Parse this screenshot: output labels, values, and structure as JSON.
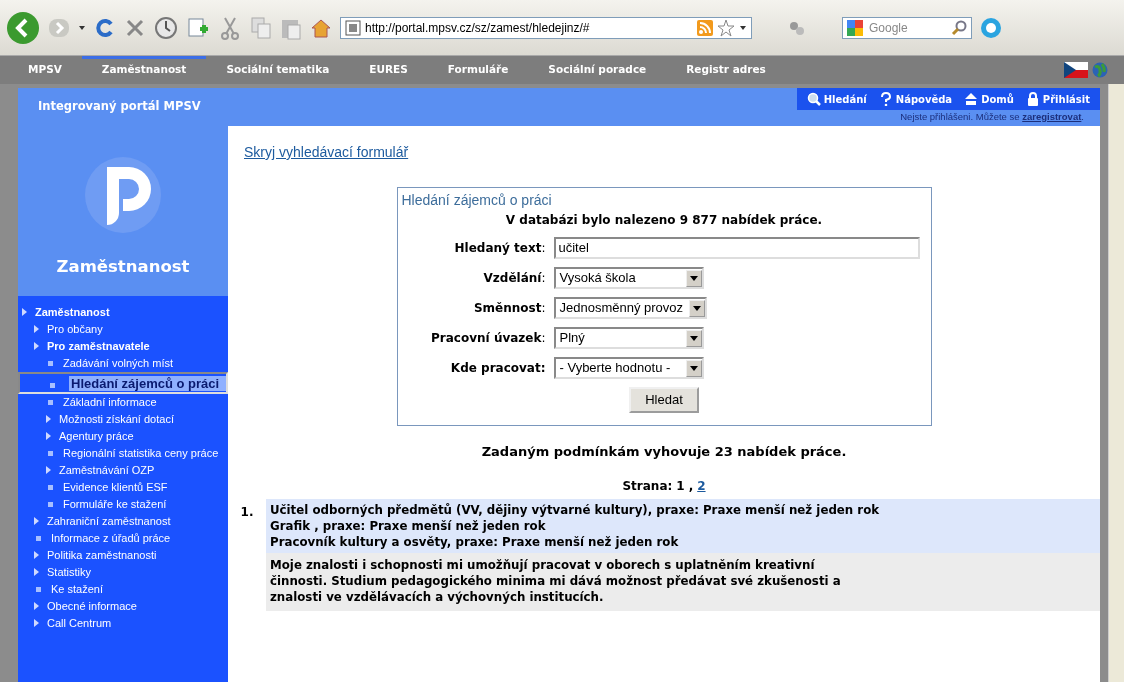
{
  "browser": {
    "url": "http://portal.mpsv.cz/sz/zamest/hledejinz/#",
    "search_placeholder": "Google"
  },
  "top_nav": [
    {
      "label": "MPSV",
      "selected": false
    },
    {
      "label": "Zaměstnanost",
      "selected": true
    },
    {
      "label": "Sociální tematika",
      "selected": false
    },
    {
      "label": "EURES",
      "selected": false
    },
    {
      "label": "Formuláře",
      "selected": false
    },
    {
      "label": "Sociální poradce",
      "selected": false
    },
    {
      "label": "Registr adres",
      "selected": false
    }
  ],
  "portal": {
    "title": "Integrovaný portál MPSV",
    "tools": [
      {
        "kind": "search",
        "label": "Hledání"
      },
      {
        "kind": "help",
        "label": "Nápověda"
      },
      {
        "kind": "home",
        "label": "Domů"
      },
      {
        "kind": "lock",
        "label": "Přihlásit"
      }
    ],
    "login_note": "Nejste přihlášeni. Můžete se",
    "register_link": "zaregistrovat",
    "note_end": "."
  },
  "sidebar": {
    "heading": "Zaměstnanost",
    "items": [
      {
        "label": "Zaměstnanost",
        "kind": "arrow",
        "expanded": true,
        "selected": false,
        "children": [
          {
            "label": "Pro občany",
            "kind": "arrow",
            "expanded": false,
            "selected": false
          },
          {
            "label": "Pro zaměstnavatele",
            "kind": "arrow",
            "expanded": true,
            "selected": false,
            "children": [
              {
                "label": "Zadávání volných míst",
                "kind": "bullet",
                "expanded": false,
                "selected": false
              },
              {
                "label": "Hledání zájemců o práci",
                "kind": "bullet",
                "expanded": false,
                "selected": true
              },
              {
                "label": "Základní informace",
                "kind": "bullet",
                "expanded": false,
                "selected": false
              },
              {
                "label": "Možnosti získání dotací",
                "kind": "arrow",
                "expanded": false,
                "selected": false
              },
              {
                "label": "Agentury práce",
                "kind": "arrow",
                "expanded": false,
                "selected": false
              },
              {
                "label": "Regionální statistika ceny práce",
                "kind": "bullet",
                "expanded": false,
                "selected": false
              },
              {
                "label": "Zaměstnávání OZP",
                "kind": "arrow",
                "expanded": false,
                "selected": false
              },
              {
                "label": "Evidence klientů ESF",
                "kind": "bullet",
                "expanded": false,
                "selected": false
              },
              {
                "label": "Formuláře ke stažení",
                "kind": "bullet",
                "expanded": false,
                "selected": false
              }
            ]
          },
          {
            "label": "Zahraniční zaměstnanost",
            "kind": "arrow",
            "expanded": false,
            "selected": false
          },
          {
            "label": "Informace z úřadů práce",
            "kind": "bullet",
            "expanded": false,
            "selected": false
          },
          {
            "label": "Politika zaměstnanosti",
            "kind": "arrow",
            "expanded": false,
            "selected": false
          },
          {
            "label": "Statistiky",
            "kind": "arrow",
            "expanded": false,
            "selected": false
          },
          {
            "label": "Ke stažení",
            "kind": "bullet",
            "expanded": false,
            "selected": false
          },
          {
            "label": "Obecné informace",
            "kind": "arrow",
            "expanded": false,
            "selected": false
          },
          {
            "label": "Call Centrum",
            "kind": "arrow",
            "expanded": false,
            "selected": false
          }
        ]
      }
    ]
  },
  "main": {
    "hide_link": "Skryj vyhledávací formulář",
    "form": {
      "legend": "Hledání zájemců o práci",
      "summary": "V databázi bylo nalezeno 9 877 nabídek práce.",
      "fields": [
        {
          "label": "Hledaný text",
          "colon": ":",
          "kind": "text",
          "value": "učitel",
          "bold_colon": false
        },
        {
          "label": "Vzdělání",
          "colon": ":",
          "kind": "select",
          "value": "Vysoká škola",
          "bold_colon": false
        },
        {
          "label": "Směnnost",
          "colon": ":",
          "kind": "select",
          "value": "Jednosměnný provoz",
          "bold_colon": false
        },
        {
          "label": "Pracovní úvazek",
          "colon": ":",
          "kind": "select",
          "value": "Plný",
          "bold_colon": false
        },
        {
          "label": "Kde pracovat",
          "colon": ":",
          "kind": "select",
          "value": "- Vyberte hodnotu -",
          "bold_colon": true
        }
      ],
      "submit": "Hledat"
    },
    "results_summary": "Zadaným podmínkám vyhovuje 23 nabídek práce.",
    "pages": {
      "label": "Strana:",
      "separator": ",",
      "items": [
        {
          "label": "1",
          "current": true
        },
        {
          "label": "2",
          "current": false
        }
      ]
    },
    "results": [
      {
        "number": "1.",
        "titles": [
          "Učitel odborných předmětů (VV, dějiny výtvarné kultury), praxe: Praxe menší než jeden rok",
          "Grafik , praxe: Praxe menší než jeden rok",
          "Pracovník kultury a osvěty, praxe: Praxe menší než jeden rok"
        ],
        "description": "Moje znalosti i schopnosti mi umožňují pracovat v oborech s uplatněním kreativní činnosti. Studium pedagogického minima mi dává možnost předávat své zkušenosti a znalosti ve vzdělávacích a výchovných institucích."
      }
    ]
  }
}
